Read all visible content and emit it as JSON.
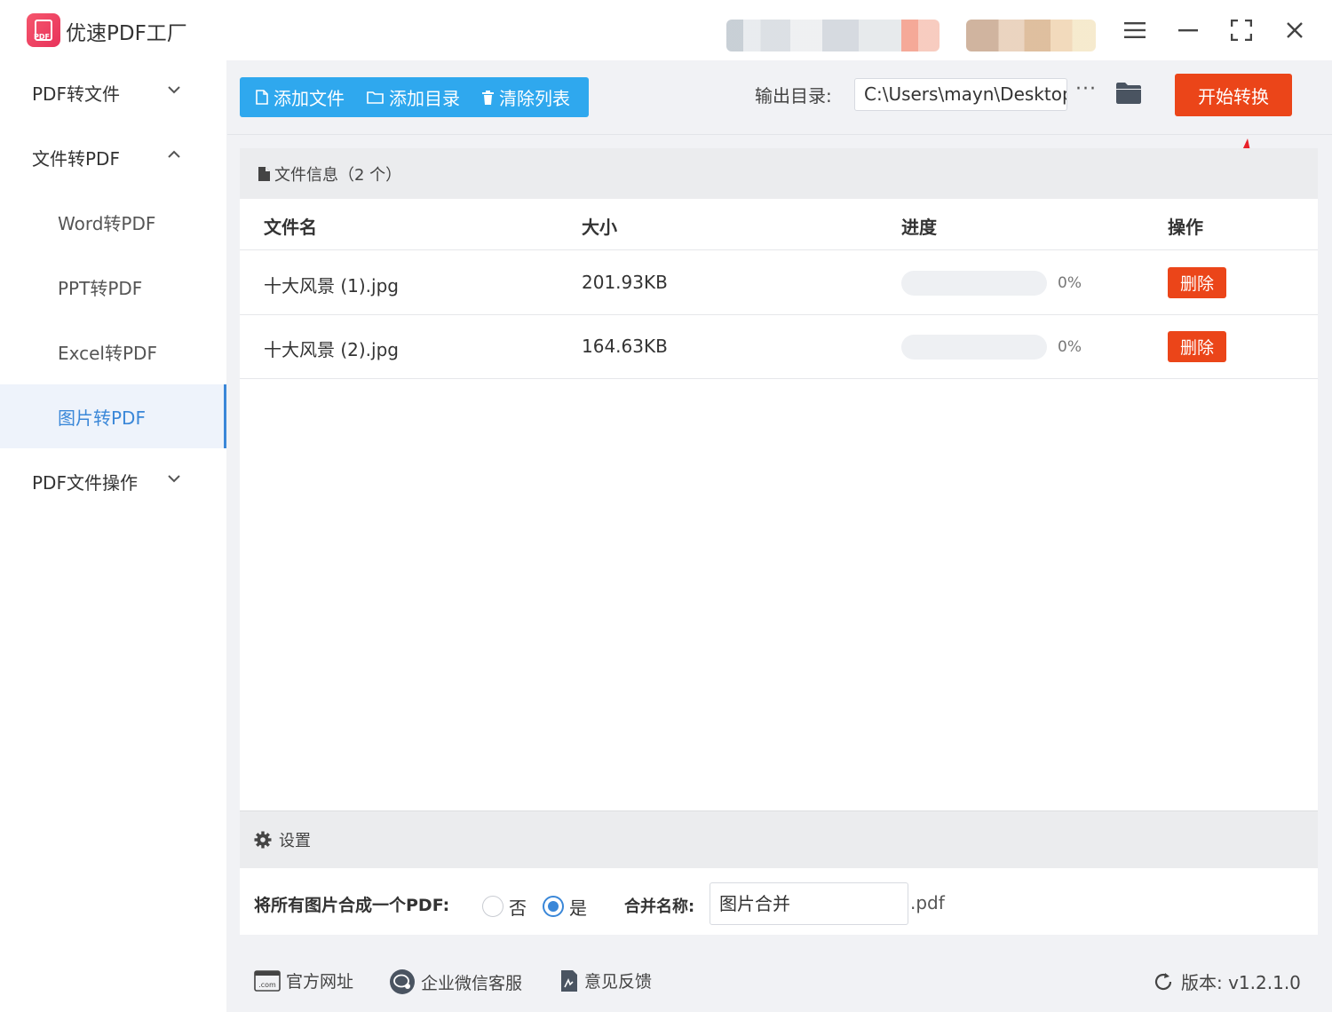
{
  "app": {
    "title": "优速PDF工厂",
    "logo_text": "PDF"
  },
  "sidebar": {
    "groups": [
      {
        "label": "PDF转文件"
      },
      {
        "label": "文件转PDF",
        "items": [
          "Word转PDF",
          "PPT转PDF",
          "Excel转PDF",
          "图片转PDF"
        ]
      },
      {
        "label": "PDF文件操作"
      }
    ],
    "active_item": "图片转PDF"
  },
  "toolbar": {
    "add_file": "添加文件",
    "add_dir": "添加目录",
    "clear_list": "清除列表",
    "output_label": "输出目录:",
    "output_path": "C:\\Users\\mayn\\Desktop",
    "more": "···",
    "start": "开始转换"
  },
  "file_panel": {
    "header": "文件信息（2 个）",
    "columns": [
      "文件名",
      "大小",
      "进度",
      "操作"
    ],
    "rows": [
      {
        "name": "十大风景 (1).jpg",
        "size": "201.93KB",
        "progress": 0,
        "progress_text": "0%",
        "action": "删除"
      },
      {
        "name": "十大风景 (2).jpg",
        "size": "164.63KB",
        "progress": 0,
        "progress_text": "0%",
        "action": "删除"
      }
    ]
  },
  "settings": {
    "header": "设置",
    "merge_label": "将所有图片合成一个PDF:",
    "option_no": "否",
    "option_yes": "是",
    "selected": "是",
    "merge_name_label": "合并名称:",
    "merge_name_value": "图片合并",
    "merge_ext": ".pdf"
  },
  "footer": {
    "website": "官方网址",
    "wechat": "企业微信客服",
    "feedback": "意见反馈",
    "version": "版本: v1.2.1.0"
  },
  "colors": {
    "accent": "#3a87d8",
    "toolbar_blue": "#2fa8ee",
    "danger": "#eb4519"
  }
}
